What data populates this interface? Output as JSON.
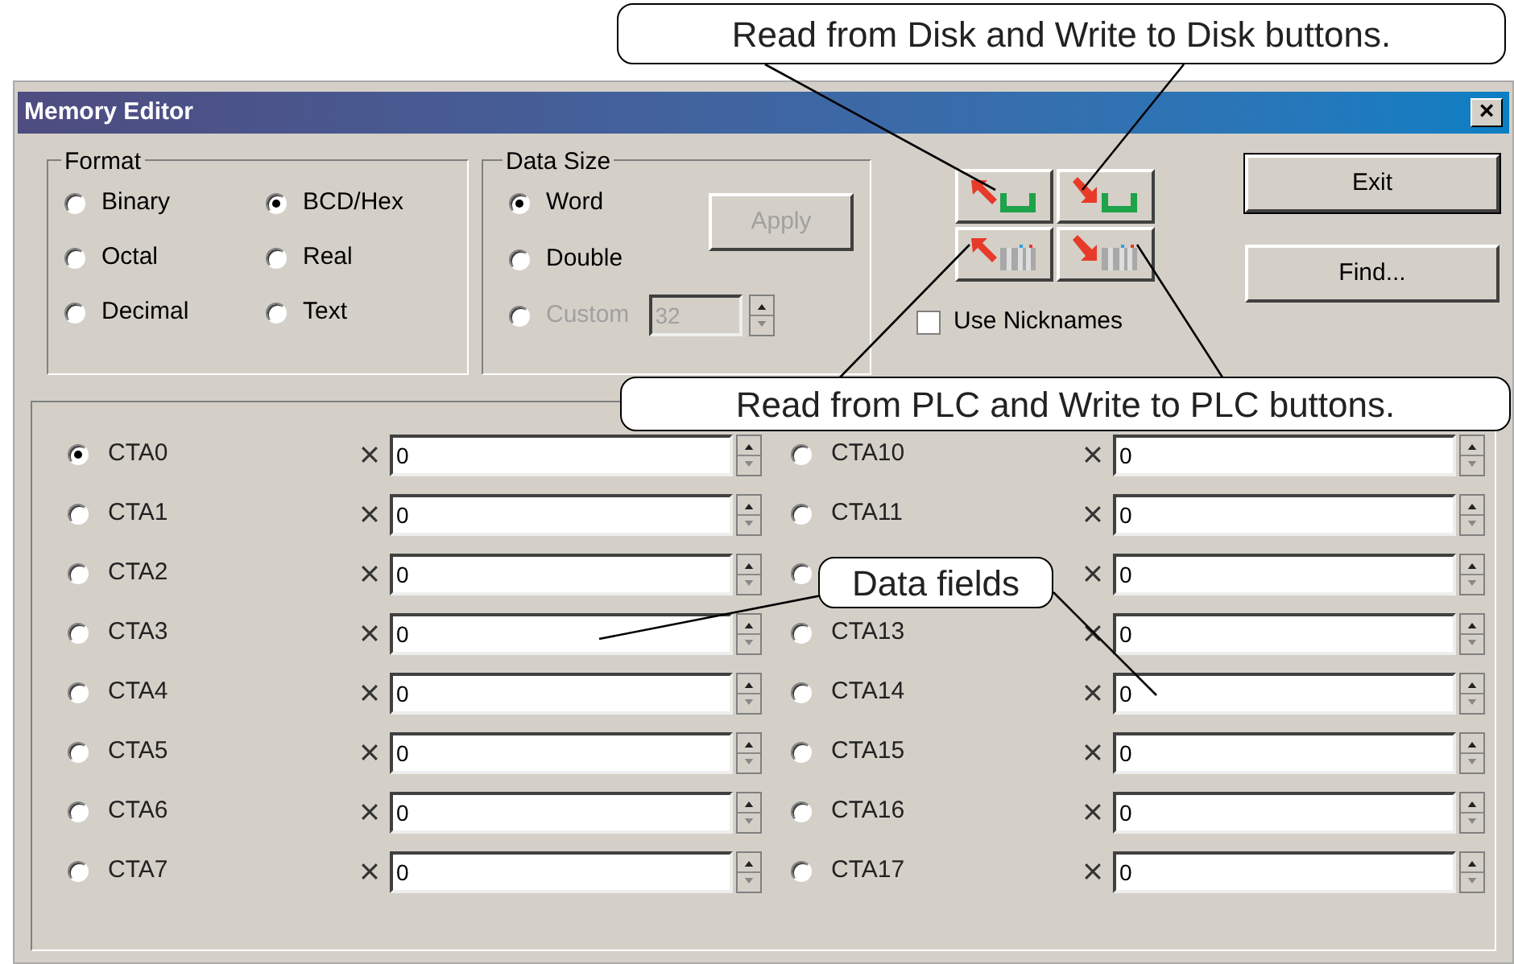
{
  "window": {
    "title": "Memory Editor",
    "close": "×"
  },
  "format": {
    "label": "Format",
    "options": [
      {
        "label": "Binary",
        "selected": false
      },
      {
        "label": "BCD/Hex",
        "selected": true
      },
      {
        "label": "Octal",
        "selected": false
      },
      {
        "label": "Real",
        "selected": false
      },
      {
        "label": "Decimal",
        "selected": false
      },
      {
        "label": "Text",
        "selected": false
      }
    ]
  },
  "data_size": {
    "label": "Data Size",
    "options": [
      {
        "label": "Word",
        "selected": true,
        "disabled": false
      },
      {
        "label": "Double",
        "selected": false,
        "disabled": false
      },
      {
        "label": "Custom",
        "selected": false,
        "disabled": true
      }
    ],
    "custom_value": "32",
    "apply": {
      "label": "Apply",
      "disabled": true
    }
  },
  "toolbar": [
    {
      "kind": "read-disk"
    },
    {
      "kind": "write-disk"
    },
    {
      "kind": "read-plc"
    },
    {
      "kind": "write-plc"
    }
  ],
  "use_nicknames": {
    "label": "Use Nicknames",
    "checked": false
  },
  "buttons": [
    "Exit",
    "Find..."
  ],
  "rows": [
    {
      "label": "CTA0",
      "selected": true,
      "value": "0"
    },
    {
      "label": "CTA1",
      "selected": false,
      "value": "0"
    },
    {
      "label": "CTA2",
      "selected": false,
      "value": "0"
    },
    {
      "label": "CTA3",
      "selected": false,
      "value": "0"
    },
    {
      "label": "CTA4",
      "selected": false,
      "value": "0"
    },
    {
      "label": "CTA5",
      "selected": false,
      "value": "0"
    },
    {
      "label": "CTA6",
      "selected": false,
      "value": "0"
    },
    {
      "label": "CTA7",
      "selected": false,
      "value": "0"
    },
    {
      "label": "CTA10",
      "selected": false,
      "value": "0"
    },
    {
      "label": "CTA11",
      "selected": false,
      "value": "0"
    },
    {
      "selected": false,
      "value": "0"
    },
    {
      "label": "CTA13",
      "selected": false,
      "value": "0"
    },
    {
      "label": "CTA14",
      "selected": false,
      "value": "0"
    },
    {
      "label": "CTA15",
      "selected": false,
      "value": "0"
    },
    {
      "label": "CTA16",
      "selected": false,
      "value": "0"
    },
    {
      "label": "CTA17",
      "selected": false,
      "value": "0"
    }
  ],
  "callouts": [
    "Read from Disk and Write to Disk buttons.",
    "Read from PLC and Write to PLC buttons.",
    "Data fields"
  ]
}
